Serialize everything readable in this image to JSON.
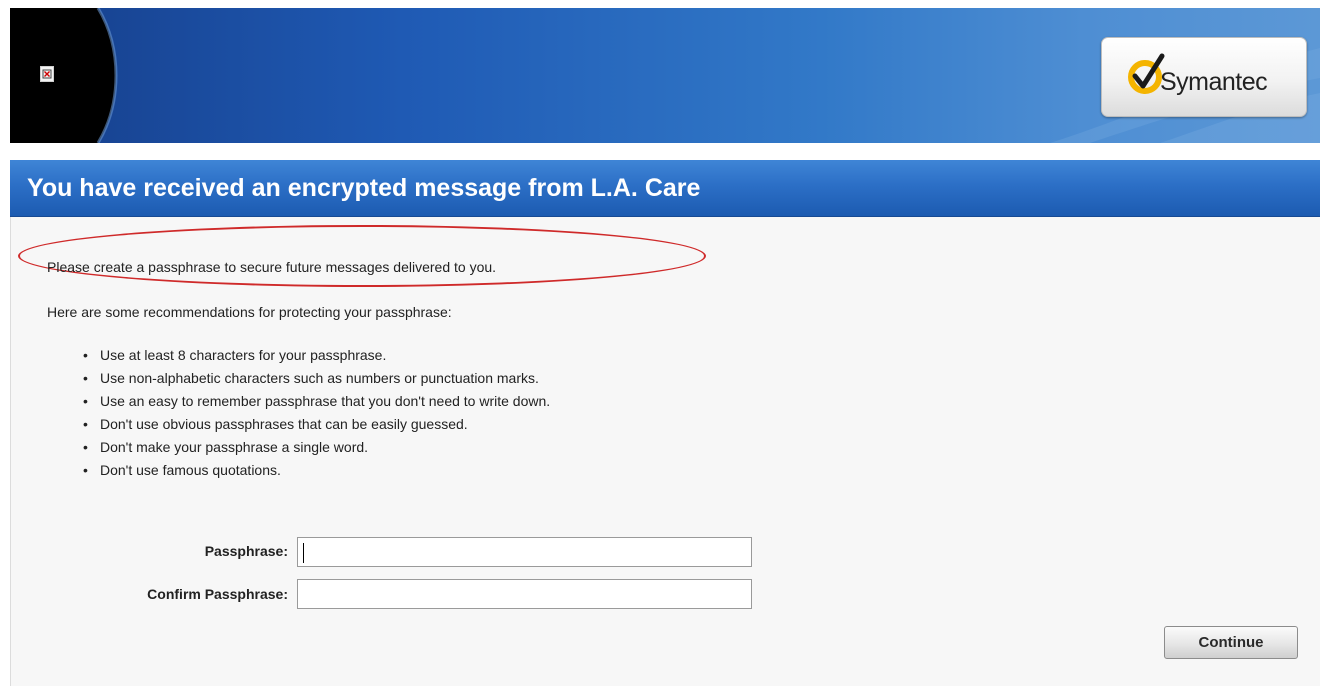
{
  "header": {
    "broken_image_icon": "broken-image-icon",
    "logo": {
      "text": "Symantec",
      "check_icon": "checkmark-icon"
    },
    "colors": {
      "banner_dark": "#163e8a",
      "banner_light": "#5c98d6",
      "logo_check": "#f4b400"
    }
  },
  "title_bar": {
    "text": "You have received an encrypted message from L.A. Care",
    "color": "#2c6fc6"
  },
  "content": {
    "intro": "Please create a passphrase to secure future messages delivered to you.",
    "highlight_color": "#cf2a2a",
    "recommendations_heading": "Here are some recommendations for protecting your passphrase:",
    "recommendations": [
      "Use at least 8 characters for your passphrase.",
      "Use non-alphabetic characters such as numbers or punctuation marks.",
      "Use an easy to remember passphrase that you don't need to write down.",
      "Don't use obvious passphrases that can be easily guessed.",
      "Don't make your passphrase a single word.",
      "Don't use famous quotations."
    ],
    "bullet": "•"
  },
  "form": {
    "passphrase": {
      "label": "Passphrase:",
      "value": ""
    },
    "confirm": {
      "label": "Confirm Passphrase:",
      "value": ""
    },
    "continue_label": "Continue"
  }
}
